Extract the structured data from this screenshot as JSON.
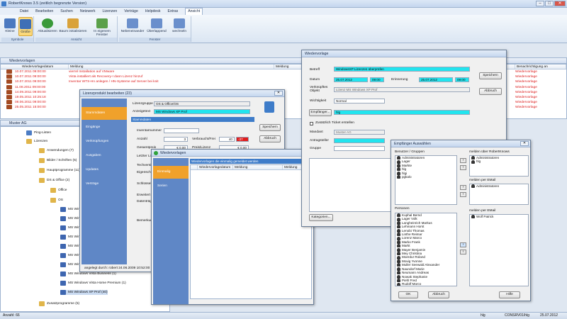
{
  "window": {
    "title": "RobertKnows 3.5 (zeitlich begrenzte Version)"
  },
  "menu": [
    "Datei",
    "Bearbeiten",
    "Suchen",
    "Netzwerk",
    "Lizenzen",
    "Verträge",
    "Helpdesk",
    "Extras",
    "Ansicht"
  ],
  "ribbon": {
    "groups": [
      {
        "label": "Symbole",
        "buttons": [
          "Kleine",
          "Große"
        ]
      },
      {
        "label": "Ansicht",
        "buttons": [
          "Aktualisieren",
          "Baum initialisieren",
          "In eigenem Fenster"
        ]
      },
      {
        "label": "Fenster",
        "buttons": [
          "Nebeneinander",
          "Überlappend",
          "wechseln"
        ]
      }
    ]
  },
  "wiedervorlagen": {
    "title": "Wiedervorlagen",
    "columns": [
      "Wiedervorlagedatum",
      "Meldung",
      "Meldung",
      "Benachrichtigung an"
    ],
    "rows": [
      {
        "date": "10.07.2011 09:00:00",
        "msg": "vierrel Installation auf VMware",
        "to": "Wiedervorlage"
      },
      {
        "date": "10.07.2011 09:00:00",
        "msg": "Vista installiert als Recovery-I dann Lizenz hinzuf",
        "to": "Wiedervorlage"
      },
      {
        "date": "10.07.2011 09:00:00",
        "msg": "Inventar WTS-Hn anlegen / HN-Systeme auf Server bei knit",
        "to": "Wiedervorlage"
      },
      {
        "date": "11.08.2011 09:00:00",
        "msg": "",
        "to": "Wiedervorlage"
      },
      {
        "date": "14.09.2011 09:00:00",
        "msg": "",
        "to": "Wiedervorlage"
      },
      {
        "date": "19.05.2011 10:25:18",
        "msg": "",
        "to": "Wiedervorlage"
      },
      {
        "date": "08.06.2011 09:00:00",
        "msg": "",
        "to": "Wiedervorlage"
      },
      {
        "date": "25.05.2011 15:00:00",
        "msg": "",
        "to": "Wiedervorlage"
      }
    ]
  },
  "tree": {
    "title": "Muster AG",
    "nodes": [
      "Ping-Listen",
      "Lizenzen",
      "Anwendungen (7)",
      "Bilder / Schriften (5)",
      "Hauptprogramme (11)",
      "DS & Office (2)",
      "Office",
      "OS",
      "MS Windows",
      "MS Windows",
      "MS Windows",
      "MS Windows",
      "MS Windows",
      "MS Windows",
      "MS Windows",
      "MS Windows Vista Business (1)",
      "MS Windows Vista Home Premium (1)",
      "MS Windows XP Prof (40)",
      "Zusatzprogramme (5)"
    ]
  },
  "lizenzprodukt": {
    "title": "Lizenzprodukt bearbeiten (23)",
    "nav": [
      "Stammdaten",
      "Eingänge",
      "Verknüpfungen",
      "Ausgaben",
      "Updates",
      "Verträge"
    ],
    "fields": {
      "lizenzgruppe_label": "Lizenzgruppe",
      "lizenzgruppe": "OS & Office/OS",
      "anzeigetext_label": "Anzeigetext",
      "anzeigetext": "MS Windows XP Prof",
      "section": "Stammdaten",
      "inventarnummer": "Inventarnummer",
      "anzahl_label": "Anzahl",
      "anzahl": "3",
      "verbraucht_label": "Verbraucht/Frei",
      "verbraucht": "40",
      "frei": "-37",
      "gesamtpreis_label": "Gesamtpreis",
      "gesamtpreis": "€ 0,00",
      "preislizenz_label": "Preis/Lizenz",
      "preislizenz": "€ 0,00",
      "letzter_label": "Letzter Lic",
      "techversion": "Techversion",
      "eigenschaften": "Eigenschaften",
      "schluessel": "Schlüssel",
      "erweitert": "Erweitert",
      "datentraeger": "Datenträger",
      "bemerkung": "Bemerkung",
      "created": "angelegt durch: robert 24.06.2009 10:52:00"
    },
    "buttons": {
      "save": "Speichern",
      "cancel": "Abbruch"
    }
  },
  "wvdialog": {
    "title": "Wiedervorlagen",
    "nav": [
      "Einmalig",
      "Serien"
    ],
    "header": "Wiedervorlagen die einmalig gemeldet werden",
    "columns": [
      "Wiedervorlagedatum",
      "Meldung",
      "Meldung"
    ]
  },
  "wiedervorlage": {
    "title": "Wiedervorlage",
    "betreff_label": "Betreff",
    "betreff": "WindowsXP Lizenzen überprüfen",
    "datum_label": "Datum",
    "datum": "25.07.2012",
    "datum_time": "09:00",
    "erinnerung_label": "Erinnerung",
    "erinnerung": "25.07.2012",
    "erinnerung_time": "09:00",
    "verkn_label": "Verknüpftes Objekt",
    "verkn": "Lizenz MS Windows XP Prof",
    "wichtigkeit_label": "Wichtigkeit",
    "wichtigkeit": "Normal",
    "empfaenger_btn": "Empfänger...",
    "empfaenger": "hlg",
    "ticket_label": "Zusätzlich Ticket erstellen",
    "mandant_label": "Mandant",
    "mandant": "Muster AG",
    "antragsteller_label": "Antragsteller",
    "gruppe_label": "Gruppe",
    "kategorien_btn": "Kategorien...",
    "buttons": {
      "save": "Speichern",
      "cancel": "Abbruch"
    }
  },
  "empfaenger": {
    "title": "Empfänger Auswählen",
    "benutzer_label": "Benutzer / Gruppen",
    "benutzer": [
      "Administratoren",
      "Lager",
      "Markte",
      "hlg",
      "hlgi",
      "pgkalo"
    ],
    "personen_label": "Personen",
    "personen": [
      "Kuphal Bernd",
      "Lager Volk",
      "Langheinrich Markus",
      "Lehmann Horst",
      "Lenobi Thomas",
      "Linthe Reimar",
      "Lorenz Marco",
      "Marko Frank",
      "Markt",
      "Mayer Benjamin",
      "Mey Christina",
      "Moerdur Roland",
      "Movig Yvonne",
      "Muller Seewald Alexander",
      "Naundorf Marie",
      "Neumann Andreas",
      "Nowak Stephanie",
      "Piehl Fred",
      "Rudolf Marco"
    ],
    "knows_label": "melden über RobertKnows",
    "knows": [
      "Administratoren",
      "hlg"
    ],
    "email_label": "melden per EMail",
    "email": [
      "Administratoren"
    ],
    "email2_label": "melden per EMail",
    "email2": [
      "Wolf Patrick"
    ],
    "buttons": {
      "ok": "OK",
      "cancel": "Abbruch",
      "help": "Hilfe"
    }
  },
  "status": {
    "left": "Anzahl: 66",
    "user": "hlg",
    "host": "CONSRV01/hlg",
    "date": "25.07.2012"
  }
}
